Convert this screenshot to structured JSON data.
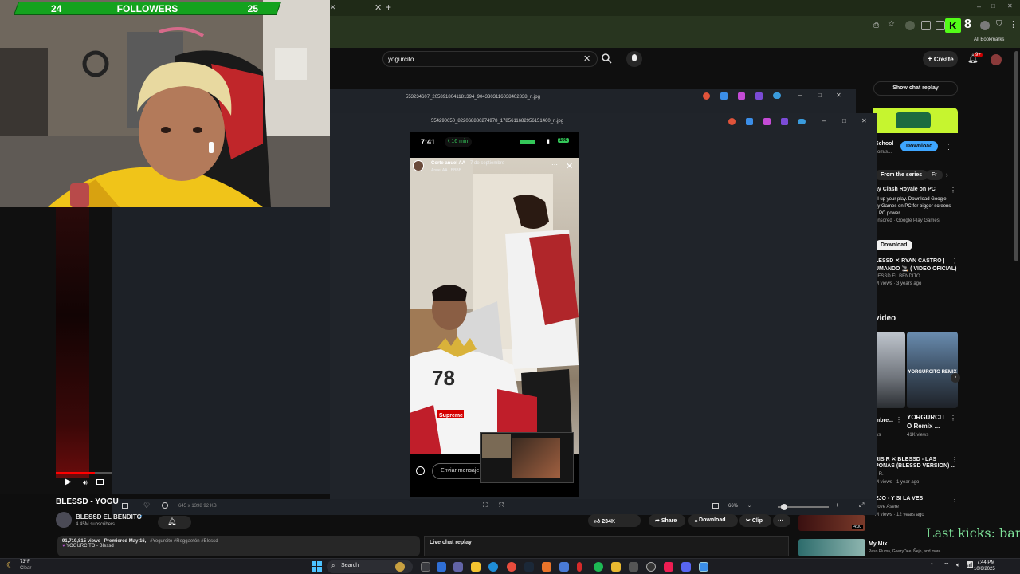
{
  "stream": {
    "followers_label": "FOLLOWERS",
    "followers_current": "24",
    "followers_goal": "25",
    "ticker": "Last kicks: bar"
  },
  "browser": {
    "bookmarks_label": "All Bookmarks",
    "badge_count": "8"
  },
  "youtube": {
    "search_value": "yogurcito",
    "create_label": "Create",
    "notif_count": "9+",
    "show_chat_replay": "Show chat replay",
    "video_title": "BLESSD - YOGU",
    "channel_name": "BLESSD EL BENDITO",
    "subscribers": "4.45M subscribers",
    "likes": "234K",
    "share_label": "Share",
    "download_label": "Download",
    "clip_label": "Clip",
    "views_line": "91,719,815 views",
    "premiered": "Premiered May 16,",
    "hashtags": "#Yogurcito #Reggaetón #Blessd",
    "song_line": "YOGURCITO - Blessd",
    "live_chat_label": "Live chat replay"
  },
  "viewer": {
    "file1": "553234607_2058918041181394_9043303116038402838_n.jpg",
    "file2": "554290650_822068880274978_1785611682956151460_n.jpg",
    "status": "645 x 1398    92 KB",
    "zoom": "66%"
  },
  "story": {
    "time": "7:41",
    "call": "16 min",
    "battery": "100",
    "user": "Corte anuel AA",
    "date": "7 de septiembre",
    "subline": "Anuel AA · BBBB",
    "message_placeholder": "Enviar mensaje",
    "shirt_brand": "Supreme"
  },
  "sidebar": {
    "ad_brand": "School",
    "ad_domain": "com/s...",
    "ad_download": "Download",
    "chip_series": "From the series",
    "chip_fr": "Fr",
    "promo_title": "ay Clash Royale on PC",
    "promo_desc_1": "el up your play. Download Google",
    "promo_desc_2": "ay Games on PC for bigger screens",
    "promo_desc_3": "d PC power.",
    "promo_sponsor": "onsored · Google Play Games",
    "promo_download": "Download",
    "rec1_title_1": "LESSD ✕ RYAN CASTRO |",
    "rec1_title_2": "UMANDO 🚬 ( VIDEO OFICIAL)",
    "rec1_channel": "LESSD EL BENDITO",
    "rec1_meta": "M views · 3 years ago",
    "section_video": "video",
    "short1_title": "mbre...",
    "short1_views": "ws",
    "short2_title_1": "YORGURCIT",
    "short2_title_2": "O Remix ...",
    "short2_views": "41K views",
    "short2_overlay": "YORGURCITO REMIX",
    "rec2_title_1": "RIS R ✕ BLESSD - LAS",
    "rec2_title_2": "PONAS (BLESSD VERSION) ...",
    "rec2_channel": "s R.",
    "rec2_meta": "M views · 1 year ago",
    "rec3_title": "EJO - Y SI LA VES",
    "rec3_channel": "Love Asere",
    "rec3_meta": "M views · 12 years ago",
    "rec4_title": "My Mix",
    "rec4_channel": "Peso Pluma, GeezyDee, Ñejo, and more",
    "mix_duration": "4:00"
  },
  "taskbar": {
    "weather_temp": "73°F",
    "weather_desc": "Clear",
    "search_label": "Search",
    "time": "7:44 PM",
    "date": "10/6/2025"
  }
}
